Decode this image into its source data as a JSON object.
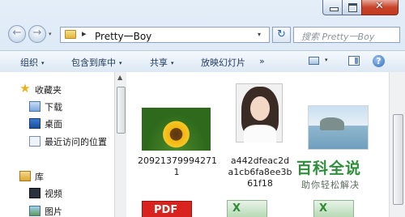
{
  "window": {
    "min_label": "",
    "max_label": "",
    "close_label": "✕"
  },
  "nav": {
    "back_glyph": "←",
    "forward_glyph": "→",
    "history_glyph": "▾"
  },
  "address": {
    "separator": "▸",
    "path": "Pretty一Boy",
    "dropdown_glyph": "▾"
  },
  "refresh_glyph": "↻",
  "search": {
    "placeholder": "搜索 Pretty一Boy"
  },
  "toolbar": {
    "organize": "组织",
    "include_library": "包含到库中",
    "share": "共享",
    "slideshow": "放映幻灯片",
    "more": "»",
    "dropdown_glyph": "▾",
    "help_glyph": "?"
  },
  "sidebar": {
    "favorites": {
      "label": "收藏夹",
      "icon": "star-icon"
    },
    "items": [
      {
        "label": "下载",
        "icon": "downloads-icon"
      },
      {
        "label": "桌面",
        "icon": "desktop-icon"
      },
      {
        "label": "最近访问的位置",
        "icon": "recent-places-icon"
      }
    ],
    "libraries": {
      "label": "库",
      "icon": "library-icon"
    },
    "lib_items": [
      {
        "label": "视频",
        "icon": "videos-icon"
      },
      {
        "label": "图片",
        "icon": "pictures-icon"
      }
    ]
  },
  "files": [
    {
      "name_line1": "20921379994271",
      "name_line2": "1",
      "kind": "sunflower-image"
    },
    {
      "name_line1": "a442dfeac2d",
      "name_line2": "a1cb6fa8ee3b",
      "name_line3": "61f18",
      "kind": "portrait-image"
    },
    {
      "kind": "seascape-image"
    },
    {
      "kind": "pdf-file",
      "badge": "PDF"
    },
    {
      "kind": "excel-file",
      "badge": "X"
    },
    {
      "kind": "excel-file",
      "badge": "X"
    }
  ],
  "watermark": {
    "title": "百科全说",
    "subtitle": "助你轻松解决"
  }
}
